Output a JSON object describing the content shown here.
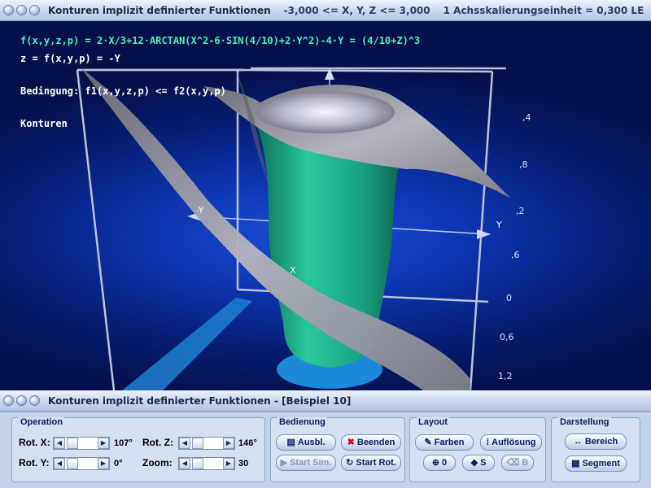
{
  "top_window": {
    "title": "Konturen implizit definierter Funktionen",
    "range_info": "-3,000 <= X, Y, Z <= 3,000",
    "scale_info": "1 Achsskalierungseinheit = 0,300 LE"
  },
  "bottom_window": {
    "title": "Konturen implizit definierter Funktionen - [Beispiel 10]"
  },
  "overlay": {
    "formula": "f(x,y,z,p) = 2·X/3+12·ARCTAN(X^2-6·SIN(4/10)+2·Y^2)-4·Y = (4/10+Z)^3",
    "z_eq": "z = f(x,y,p) = -Y",
    "condition": "Bedingung: f1(x,y,z,p) <= f2(x,y,p)",
    "mode": "Konturen"
  },
  "axes": {
    "labels": {
      "x": "X",
      "y_left": "-Y",
      "y_right": "Y"
    },
    "ticks": [
      ",4",
      ",8",
      ",2",
      ",6",
      "0",
      "0,6",
      "1,2"
    ]
  },
  "operation": {
    "title": "Operation",
    "rot_x_label": "Rot. X:",
    "rot_x_value": "107°",
    "rot_y_label": "Rot. Y:",
    "rot_y_value": "0°",
    "rot_z_label": "Rot. Z:",
    "rot_z_value": "146°",
    "zoom_label": "Zoom:",
    "zoom_value": "30"
  },
  "bedienung": {
    "title": "Bedienung",
    "ausbl": "Ausbl.",
    "beenden": "Beenden",
    "start_sim": "Start Sim.",
    "start_rot": "Start Rot."
  },
  "layout": {
    "title": "Layout",
    "farben": "Farben",
    "aufloesung": "Auflösung",
    "o_label": "0",
    "s_label": "S",
    "b_label": "B"
  },
  "darstellung": {
    "title": "Darstellung",
    "bereich": "Bereich",
    "segment": "Segment"
  },
  "colors": {
    "background": "#0d34b0",
    "surface_green": "#1fae8a",
    "surface_gray": "#9a9aa6",
    "formula_text": "#4ef0b8"
  }
}
